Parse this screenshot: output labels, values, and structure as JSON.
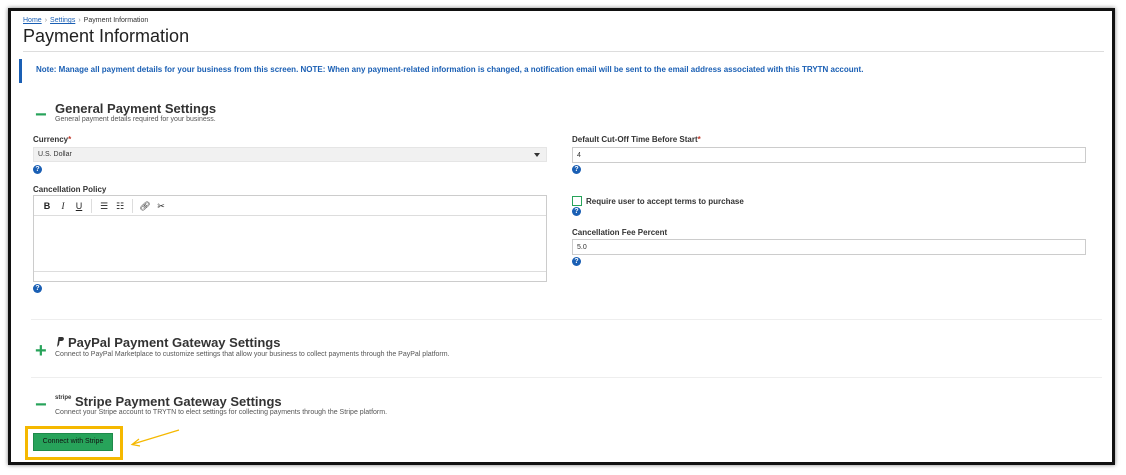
{
  "breadcrumb": {
    "home": "Home",
    "settings": "Settings",
    "current": "Payment Information",
    "sep": "›"
  },
  "page_title": "Payment Information",
  "note": "Note: Manage all payment details for your business from this screen. NOTE: When any payment-related information is changed, a notification email will be sent to the email address associated with this TRYTN account.",
  "general": {
    "toggle": "−",
    "title": "General Payment Settings",
    "subtitle": "General payment details required for your business.",
    "currency_label": "Currency",
    "currency_value": "U.S. Dollar",
    "cutoff_label": "Default Cut-Off Time Before Start",
    "cutoff_value": "4",
    "cancellation_policy_label": "Cancellation Policy",
    "terms_label": "Require user to accept terms to purchase",
    "fee_label": "Cancellation Fee Percent",
    "fee_value": "5.0",
    "required_mark": "*"
  },
  "paypal": {
    "toggle": "+",
    "title": "PayPal Payment Gateway Settings",
    "subtitle": "Connect to PayPal Marketplace to customize settings that allow your business to collect payments through the PayPal platform."
  },
  "stripe": {
    "toggle": "−",
    "logo_text": "stripe",
    "title": "Stripe Payment Gateway Settings",
    "subtitle": "Connect your Stripe account to TRYTN to elect settings for collecting payments through the Stripe platform.",
    "connect_label": "Connect with Stripe"
  },
  "colors": {
    "accent_green": "#27a35a",
    "link_blue": "#1a5fb4",
    "highlight": "#f5b800",
    "arrow": "#f5b800"
  }
}
